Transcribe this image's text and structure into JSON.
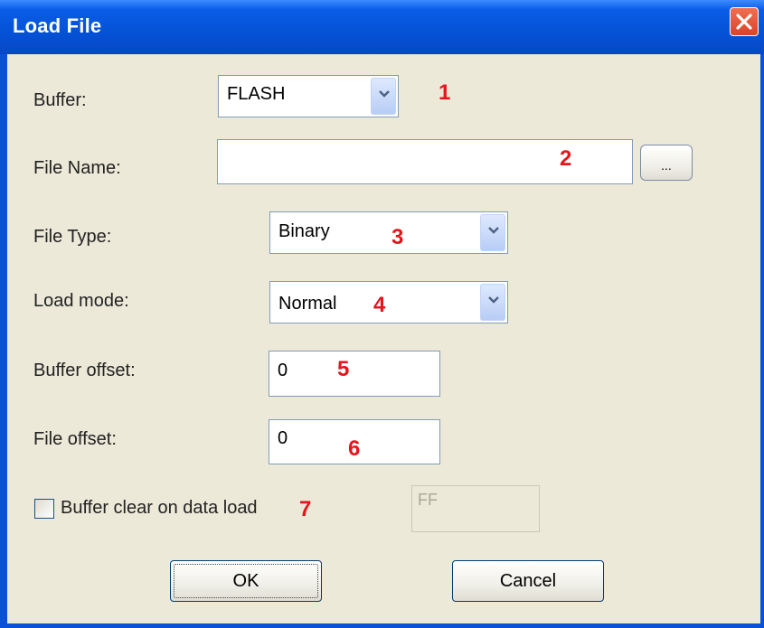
{
  "window": {
    "title": "Load File"
  },
  "form": {
    "buffer": {
      "label": "Buffer:",
      "value": "FLASH"
    },
    "file_name": {
      "label": "File Name:",
      "value": "",
      "browse_label": "..."
    },
    "file_type": {
      "label": "File Type:",
      "value": "Binary"
    },
    "load_mode": {
      "label": "Load mode:",
      "value": "Normal"
    },
    "buffer_offset": {
      "label": "Buffer offset:",
      "value": "0"
    },
    "file_offset": {
      "label": "File offset:",
      "value": "0"
    },
    "buffer_clear": {
      "label": "Buffer clear on data load",
      "checked": false,
      "fill_value": "FF"
    }
  },
  "buttons": {
    "ok": "OK",
    "cancel": "Cancel"
  },
  "annotations": [
    "1",
    "2",
    "3",
    "4",
    "5",
    "6",
    "7"
  ],
  "colors": {
    "title_bar": "#0552d6",
    "dialog_bg": "#ece9d8",
    "annotation": "#e4161b",
    "close_button": "#d8442a"
  }
}
